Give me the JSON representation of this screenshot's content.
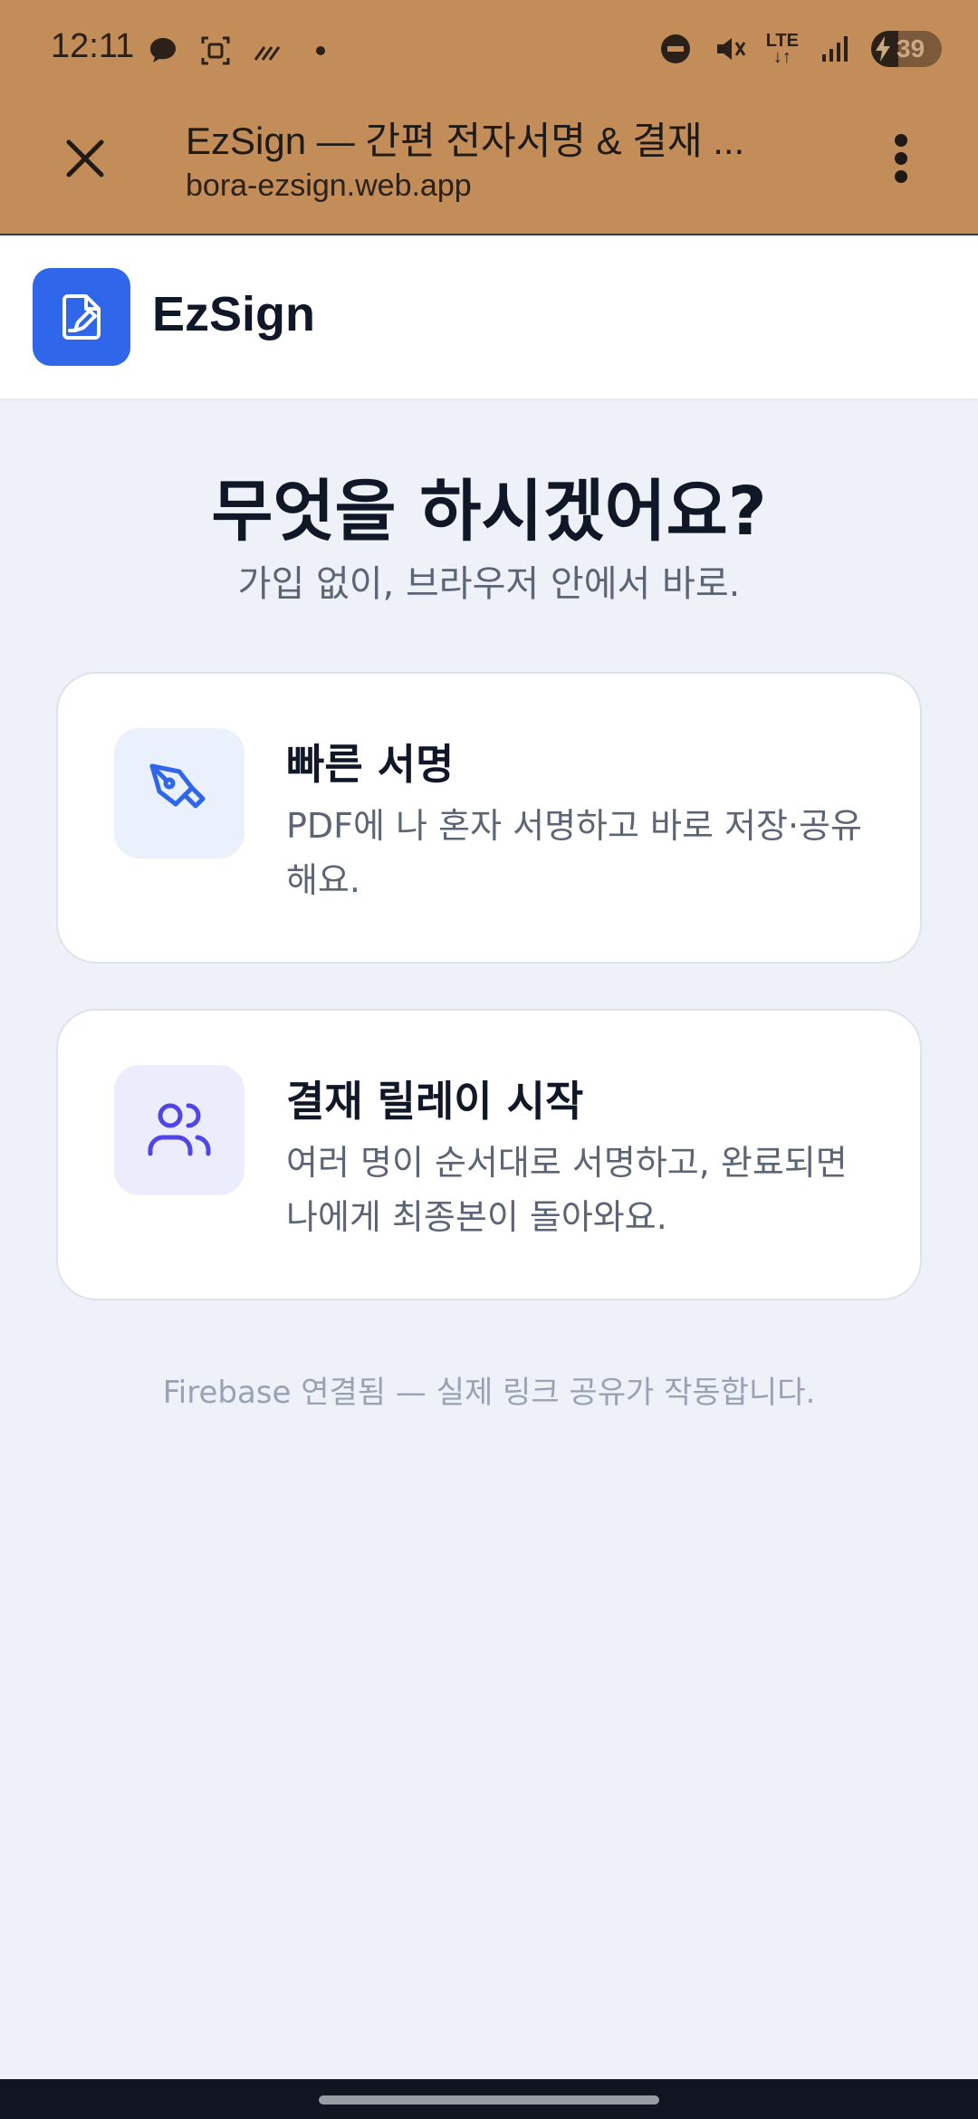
{
  "status_bar": {
    "time": "12:11",
    "network": "LTE",
    "battery_percent": "39",
    "battery_level": 0.39
  },
  "browser": {
    "tab_title": "EzSign — 간편 전자서명 & 결재 ...",
    "url": "bora-ezsign.web.app",
    "close_icon": "close-icon",
    "menu_icon": "more-vertical-icon"
  },
  "app": {
    "brand": "EzSign",
    "logo_icon": "document-sign-icon",
    "accent": "#2f66ea"
  },
  "main": {
    "headline": "무엇을 하시겠어요?",
    "subline": "가입 없이, 브라우저 안에서 바로.",
    "cards": [
      {
        "title": "빠른 서명",
        "description": "PDF에 나 혼자 서명하고 바로 저장·공유해요.",
        "icon": "pen-nib-icon",
        "icon_color": "#2f66ea"
      },
      {
        "title": "결재 릴레이 시작",
        "description": "여러 명이 순서대로 서명하고, 완료되면 나에게 최종본이 돌아와요.",
        "icon": "users-icon",
        "icon_color": "#4f46e5"
      }
    ],
    "footnote": "Firebase 연결됨 — 실제 링크 공유가 작동합니다."
  }
}
